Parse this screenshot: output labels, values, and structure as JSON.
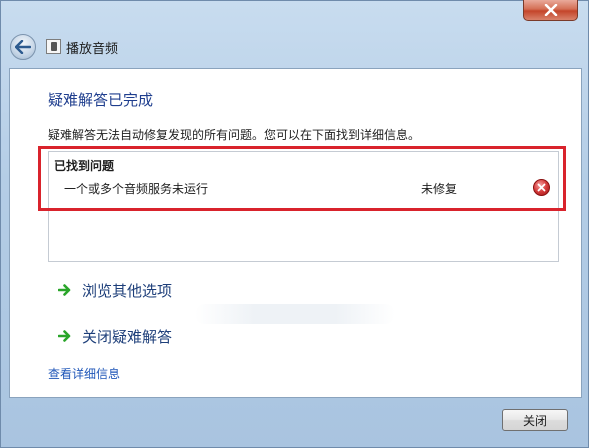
{
  "window": {
    "title": "播放音频"
  },
  "content": {
    "heading": "疑难解答已完成",
    "description": "疑难解答无法自动修复发现的所有问题。您可以在下面找到详细信息。",
    "problems": {
      "title": "已找到问题",
      "items": [
        {
          "name": "一个或多个音频服务未运行",
          "status": "未修复"
        }
      ]
    },
    "options": [
      {
        "label": "浏览其他选项"
      },
      {
        "label": "关闭疑难解答"
      }
    ],
    "details_link": "查看详细信息"
  },
  "footer": {
    "close_label": "关闭"
  },
  "colors": {
    "heading": "#1f3e8e",
    "link": "#1f56b8",
    "highlight": "#d9232c",
    "arrow": "#2aa52a"
  }
}
